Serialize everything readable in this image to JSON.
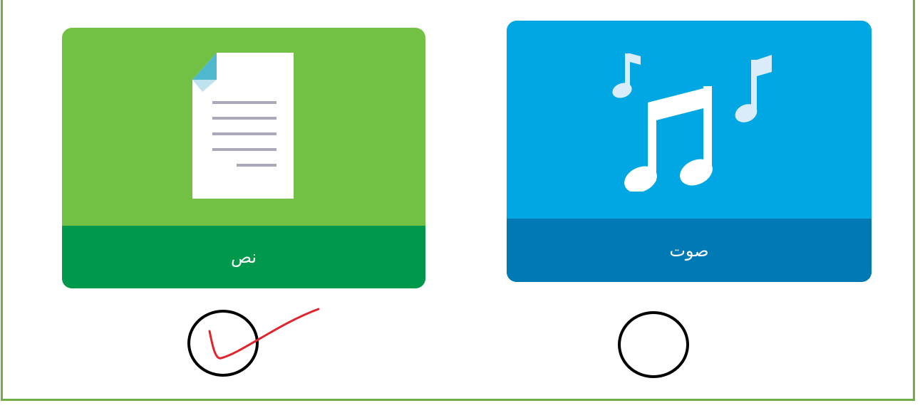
{
  "options": [
    {
      "label": "نص",
      "icon": "document-icon",
      "color": "#72c044",
      "band_color": "#00984a",
      "selected": true
    },
    {
      "label": "صوت",
      "icon": "music-notes-icon",
      "color": "#00a7e3",
      "band_color": "#0079b4",
      "selected": false
    }
  ],
  "colors": {
    "frame": "#70ad47",
    "check": "#e0242c"
  }
}
